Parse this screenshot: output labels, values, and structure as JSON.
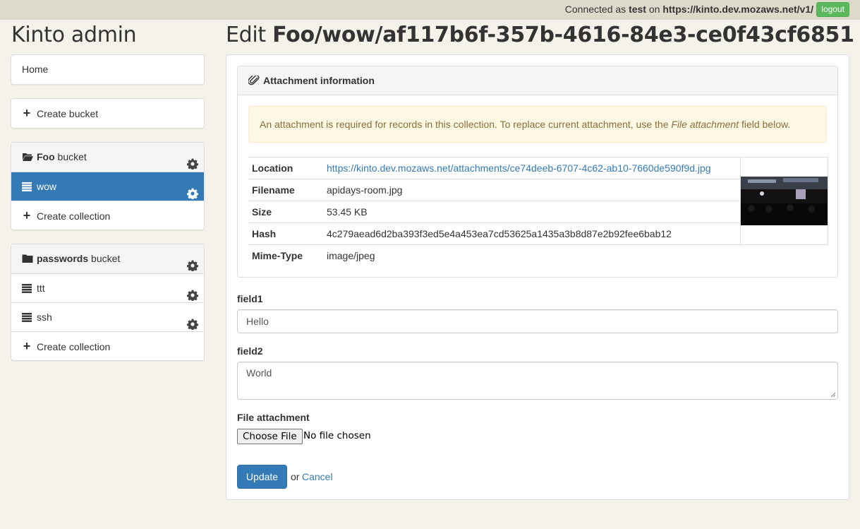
{
  "topbar": {
    "connected_prefix": "Connected as",
    "user": "test",
    "on_text": "on",
    "server": "https://kinto.dev.mozaws.net/v1/",
    "logout_label": "logout"
  },
  "app_title": "Kinto admin",
  "sidebar": {
    "home_label": "Home",
    "create_bucket_label": "Create bucket",
    "buckets": [
      {
        "name": "Foo",
        "suffix": "bucket",
        "collections": [
          "wow"
        ],
        "create_collection_label": "Create collection"
      },
      {
        "name": "passwords",
        "suffix": "bucket",
        "collections": [
          "ttt",
          "ssh"
        ],
        "create_collection_label": "Create collection"
      }
    ]
  },
  "page": {
    "title_prefix": "Edit",
    "title_path": "Foo/wow/af117b6f-357b-4616-84e3-ce0f43cf6851"
  },
  "attachment": {
    "header": "Attachment information",
    "alert_before": "An attachment is required for records in this collection. To replace current attachment, use the",
    "alert_em": "File attachment",
    "alert_after": "field below.",
    "rows": [
      {
        "key": "Location",
        "value": "https://kinto.dev.mozaws.net/attachments/ce74deeb-6707-4c62-ab10-7660de590f9d.jpg"
      },
      {
        "key": "Filename",
        "value": "apidays-room.jpg"
      },
      {
        "key": "Size",
        "value": "53.45 KB"
      },
      {
        "key": "Hash",
        "value": "4c279aead6d2ba393f3ed5e4a453ea7cd53625a1435a3b8d87e2b92fee6bab12"
      },
      {
        "key": "Mime-Type",
        "value": "image/jpeg"
      }
    ]
  },
  "form": {
    "field1_label": "field1",
    "field1_value": "Hello",
    "field2_label": "field2",
    "field2_value": "World",
    "file_label": "File attachment",
    "choose_file_label": "Choose File",
    "no_file_text": "No file chosen",
    "update_label": "Update",
    "or_text": "or",
    "cancel_label": "Cancel"
  },
  "colors": {
    "primary": "#337ab7",
    "success": "#5cb85c",
    "warning_bg": "#fcf8e3",
    "warning_text": "#8a6d3b",
    "page_bg": "#f5f2ea",
    "topbar_bg": "#ddd9cb"
  }
}
